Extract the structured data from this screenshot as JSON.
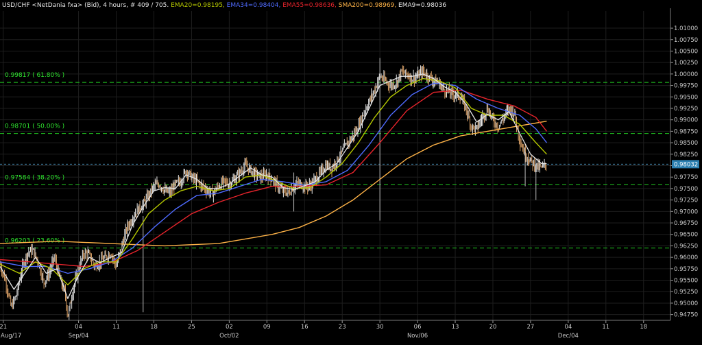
{
  "header": {
    "symbol": "USD/CHF <NetDania fxa> (Bid), 4 hours, # 409 / 705.",
    "indicators": [
      {
        "label": "EMA20=0.98195",
        "color": "#b5c800"
      },
      {
        "label": "EMA34=0.98404",
        "color": "#4f6bff"
      },
      {
        "label": "EMA55=0.98636",
        "color": "#e8242c"
      },
      {
        "label": "SMA200=0.98969",
        "color": "#ffb347"
      },
      {
        "label": "EMA9=0.98036",
        "color": "#e6e6e6"
      }
    ]
  },
  "colors": {
    "background": "#000000",
    "grid": "#1e1e1e",
    "fib": "#22cc22",
    "price_line": "#4a8fb8",
    "price_tag": "#2b7fb0",
    "bar_up": "#e6e6e6",
    "bar_down": "#d9a066"
  },
  "chart_data": {
    "type": "line",
    "title": "USD/CHF <NetDania fxa> (Bid), 4 hours, # 409 / 705.",
    "ylim": [
      0.94625,
      1.01375
    ],
    "y_ticks": [
      "1.01000",
      "1.00750",
      "1.00500",
      "1.00250",
      "1.00000",
      "0.99750",
      "0.99500",
      "0.99250",
      "0.99000",
      "0.98750",
      "0.98500",
      "0.98250",
      "0.98000",
      "0.97750",
      "0.97500",
      "0.97250",
      "0.97000",
      "0.96750",
      "0.96500",
      "0.96250",
      "0.96000",
      "0.95750",
      "0.95500",
      "0.95250",
      "0.95000",
      "0.94750"
    ],
    "y_tick_values": [
      1.01,
      1.0075,
      1.005,
      1.0025,
      1.0,
      0.9975,
      0.995,
      0.9925,
      0.99,
      0.9875,
      0.985,
      0.9825,
      0.98,
      0.9775,
      0.975,
      0.9725,
      0.97,
      0.9675,
      0.965,
      0.9625,
      0.96,
      0.9575,
      0.955,
      0.9525,
      0.95,
      0.9475
    ],
    "x_day_ticks": [
      {
        "day": 0,
        "label": "21"
      },
      {
        "day": 14,
        "label": "04"
      },
      {
        "day": 21,
        "label": "11"
      },
      {
        "day": 28,
        "label": "18"
      },
      {
        "day": 35,
        "label": "25"
      },
      {
        "day": 42,
        "label": "02"
      },
      {
        "day": 49,
        "label": "09"
      },
      {
        "day": 56,
        "label": "16"
      },
      {
        "day": 63,
        "label": "23"
      },
      {
        "day": 70,
        "label": "30"
      },
      {
        "day": 77,
        "label": "06"
      },
      {
        "day": 84,
        "label": "13"
      },
      {
        "day": 91,
        "label": "20"
      },
      {
        "day": 98,
        "label": "27"
      },
      {
        "day": 105,
        "label": "04"
      },
      {
        "day": 112,
        "label": "11"
      },
      {
        "day": 119,
        "label": "18"
      }
    ],
    "x_month_labels": [
      {
        "day": 0,
        "label": "Aug/17"
      },
      {
        "day": 14,
        "label": "Sep/04"
      },
      {
        "day": 42,
        "label": "Oct/02"
      },
      {
        "day": 77,
        "label": "Nov/06"
      },
      {
        "day": 105,
        "label": "Dec/04"
      }
    ],
    "x_day_range": [
      0,
      124
    ],
    "fib_levels": [
      {
        "label": "0.99817 ( 61.80% )",
        "value": 0.99817
      },
      {
        "label": "0.98701 ( 50.00% )",
        "value": 0.98701
      },
      {
        "label": "0.97584 ( 38.20% )",
        "value": 0.97584
      },
      {
        "label": "0.96203 ( 23.60% )",
        "value": 0.96203
      }
    ],
    "current_price": {
      "label": "0.98032",
      "value": 0.98032
    },
    "price_path": [
      [
        -0.6,
        0.9585
      ],
      [
        0.5,
        0.9545
      ],
      [
        1.5,
        0.949
      ],
      [
        2.5,
        0.952
      ],
      [
        3.5,
        0.9575
      ],
      [
        4.5,
        0.961
      ],
      [
        5.5,
        0.9615
      ],
      [
        6.5,
        0.959
      ],
      [
        7.5,
        0.9545
      ],
      [
        8.5,
        0.9565
      ],
      [
        9.5,
        0.96
      ],
      [
        10.5,
        0.9555
      ],
      [
        11.5,
        0.952
      ],
      [
        12,
        0.947
      ],
      [
        13,
        0.953
      ],
      [
        14,
        0.9575
      ],
      [
        15,
        0.961
      ],
      [
        16,
        0.9605
      ],
      [
        17,
        0.958
      ],
      [
        18,
        0.959
      ],
      [
        19,
        0.96
      ],
      [
        20,
        0.961
      ],
      [
        21,
        0.958
      ],
      [
        22,
        0.9625
      ],
      [
        23,
        0.9665
      ],
      [
        24,
        0.9685
      ],
      [
        25,
        0.9705
      ],
      [
        26,
        0.9715
      ],
      [
        27,
        0.9735
      ],
      [
        28,
        0.9755
      ],
      [
        29,
        0.976
      ],
      [
        30,
        0.9745
      ],
      [
        31,
        0.974
      ],
      [
        32,
        0.976
      ],
      [
        33,
        0.9765
      ],
      [
        34,
        0.979
      ],
      [
        35,
        0.9775
      ],
      [
        36,
        0.9765
      ],
      [
        37,
        0.9755
      ],
      [
        38,
        0.9745
      ],
      [
        39,
        0.974
      ],
      [
        40,
        0.9755
      ],
      [
        41,
        0.9765
      ],
      [
        42,
        0.976
      ],
      [
        43,
        0.977
      ],
      [
        44,
        0.9785
      ],
      [
        45,
        0.98
      ],
      [
        46,
        0.979
      ],
      [
        47,
        0.978
      ],
      [
        48,
        0.9775
      ],
      [
        49,
        0.978
      ],
      [
        50,
        0.977
      ],
      [
        51,
        0.9755
      ],
      [
        52,
        0.9745
      ],
      [
        53,
        0.974
      ],
      [
        54,
        0.9755
      ],
      [
        55,
        0.976
      ],
      [
        56,
        0.9755
      ],
      [
        57,
        0.9755
      ],
      [
        58,
        0.977
      ],
      [
        59,
        0.9785
      ],
      [
        60,
        0.98
      ],
      [
        61,
        0.9795
      ],
      [
        62,
        0.981
      ],
      [
        63,
        0.983
      ],
      [
        64,
        0.985
      ],
      [
        65,
        0.9865
      ],
      [
        66,
        0.9885
      ],
      [
        67,
        0.9915
      ],
      [
        68,
        0.994
      ],
      [
        69,
        0.9965
      ],
      [
        70,
        0.9995
      ],
      [
        71,
        0.9985
      ],
      [
        72,
        0.9975
      ],
      [
        73,
        0.998
      ],
      [
        74,
        1.0005
      ],
      [
        75,
        1.0
      ],
      [
        76,
        0.999
      ],
      [
        77,
        0.9995
      ],
      [
        78,
        1.0005
      ],
      [
        79,
        0.9995
      ],
      [
        80,
        0.9985
      ],
      [
        81,
        0.998
      ],
      [
        82,
        0.9965
      ],
      [
        83,
        0.996
      ],
      [
        84,
        0.9955
      ],
      [
        85,
        0.995
      ],
      [
        86,
        0.9925
      ],
      [
        87,
        0.9885
      ],
      [
        88,
        0.988
      ],
      [
        89,
        0.9905
      ],
      [
        90,
        0.9925
      ],
      [
        91,
        0.99
      ],
      [
        92,
        0.9885
      ],
      [
        93,
        0.9905
      ],
      [
        94,
        0.9925
      ],
      [
        95,
        0.9915
      ],
      [
        96,
        0.9855
      ],
      [
        97,
        0.9825
      ],
      [
        98,
        0.981
      ],
      [
        99,
        0.98
      ],
      [
        100,
        0.9795
      ],
      [
        101,
        0.9803
      ]
    ],
    "series": [
      {
        "name": "EMA20",
        "color": "#b5c800",
        "points": [
          [
            -0.6,
            0.9585
          ],
          [
            3,
            0.9565
          ],
          [
            6,
            0.959
          ],
          [
            9,
            0.9575
          ],
          [
            12,
            0.954
          ],
          [
            15,
            0.9575
          ],
          [
            18,
            0.959
          ],
          [
            21,
            0.959
          ],
          [
            24,
            0.964
          ],
          [
            27,
            0.9695
          ],
          [
            30,
            0.9725
          ],
          [
            33,
            0.9745
          ],
          [
            36,
            0.9755
          ],
          [
            39,
            0.9745
          ],
          [
            42,
            0.975
          ],
          [
            45,
            0.9775
          ],
          [
            48,
            0.978
          ],
          [
            51,
            0.9765
          ],
          [
            54,
            0.975
          ],
          [
            57,
            0.9752
          ],
          [
            60,
            0.9775
          ],
          [
            63,
            0.9805
          ],
          [
            66,
            0.985
          ],
          [
            69,
            0.9905
          ],
          [
            72,
            0.995
          ],
          [
            75,
            0.9975
          ],
          [
            78,
            0.999
          ],
          [
            81,
            0.9985
          ],
          [
            84,
            0.997
          ],
          [
            87,
            0.9925
          ],
          [
            90,
            0.991
          ],
          [
            93,
            0.991
          ],
          [
            96,
            0.989
          ],
          [
            99,
            0.985
          ],
          [
            101,
            0.9825
          ]
        ]
      },
      {
        "name": "EMA34",
        "color": "#4f6bff",
        "points": [
          [
            -0.6,
            0.959
          ],
          [
            4,
            0.958
          ],
          [
            8,
            0.958
          ],
          [
            12,
            0.9565
          ],
          [
            16,
            0.9575
          ],
          [
            20,
            0.959
          ],
          [
            24,
            0.962
          ],
          [
            28,
            0.9665
          ],
          [
            32,
            0.9705
          ],
          [
            36,
            0.9735
          ],
          [
            40,
            0.974
          ],
          [
            44,
            0.9755
          ],
          [
            48,
            0.977
          ],
          [
            52,
            0.9765
          ],
          [
            56,
            0.9757
          ],
          [
            60,
            0.9765
          ],
          [
            64,
            0.979
          ],
          [
            68,
            0.9845
          ],
          [
            72,
            0.991
          ],
          [
            76,
            0.9955
          ],
          [
            80,
            0.998
          ],
          [
            84,
            0.9975
          ],
          [
            88,
            0.9945
          ],
          [
            92,
            0.9925
          ],
          [
            96,
            0.991
          ],
          [
            99,
            0.988
          ],
          [
            101,
            0.985
          ]
        ]
      },
      {
        "name": "EMA55",
        "color": "#e8242c",
        "points": [
          [
            -0.6,
            0.9595
          ],
          [
            5,
            0.959
          ],
          [
            10,
            0.9585
          ],
          [
            15,
            0.958
          ],
          [
            20,
            0.9588
          ],
          [
            25,
            0.9615
          ],
          [
            30,
            0.9655
          ],
          [
            35,
            0.9695
          ],
          [
            40,
            0.972
          ],
          [
            45,
            0.974
          ],
          [
            50,
            0.9755
          ],
          [
            55,
            0.9755
          ],
          [
            60,
            0.9758
          ],
          [
            65,
            0.9785
          ],
          [
            70,
            0.985
          ],
          [
            75,
            0.992
          ],
          [
            80,
            0.996
          ],
          [
            85,
            0.9965
          ],
          [
            90,
            0.9945
          ],
          [
            95,
            0.993
          ],
          [
            99,
            0.9905
          ],
          [
            101,
            0.9875
          ]
        ]
      },
      {
        "name": "SMA200",
        "color": "#ffb347",
        "points": [
          [
            -0.6,
            0.963
          ],
          [
            10,
            0.9635
          ],
          [
            20,
            0.963
          ],
          [
            30,
            0.9625
          ],
          [
            40,
            0.963
          ],
          [
            50,
            0.965
          ],
          [
            55,
            0.9665
          ],
          [
            60,
            0.969
          ],
          [
            65,
            0.9725
          ],
          [
            70,
            0.977
          ],
          [
            75,
            0.9815
          ],
          [
            80,
            0.9845
          ],
          [
            85,
            0.9865
          ],
          [
            90,
            0.9875
          ],
          [
            95,
            0.9885
          ],
          [
            101,
            0.9897
          ]
        ]
      },
      {
        "name": "EMA9",
        "color": "#e6e6e6",
        "points": [
          [
            -0.6,
            0.958
          ],
          [
            2,
            0.953
          ],
          [
            4,
            0.9565
          ],
          [
            6,
            0.96
          ],
          [
            8,
            0.9565
          ],
          [
            10,
            0.9575
          ],
          [
            12,
            0.951
          ],
          [
            14,
            0.956
          ],
          [
            16,
            0.96
          ],
          [
            18,
            0.9588
          ],
          [
            20,
            0.96
          ],
          [
            22,
            0.961
          ],
          [
            24,
            0.967
          ],
          [
            26,
            0.971
          ],
          [
            28,
            0.9745
          ],
          [
            30,
            0.9752
          ],
          [
            32,
            0.975
          ],
          [
            34,
            0.978
          ],
          [
            36,
            0.977
          ],
          [
            38,
            0.975
          ],
          [
            40,
            0.975
          ],
          [
            42,
            0.976
          ],
          [
            44,
            0.9778
          ],
          [
            46,
            0.9795
          ],
          [
            48,
            0.978
          ],
          [
            50,
            0.9775
          ],
          [
            52,
            0.9752
          ],
          [
            54,
            0.9748
          ],
          [
            56,
            0.9756
          ],
          [
            58,
            0.9765
          ],
          [
            60,
            0.979
          ],
          [
            62,
            0.9805
          ],
          [
            64,
            0.984
          ],
          [
            66,
            0.9875
          ],
          [
            68,
            0.9925
          ],
          [
            70,
            0.9975
          ],
          [
            72,
            0.9985
          ],
          [
            74,
            0.9995
          ],
          [
            76,
            0.9995
          ],
          [
            78,
            1.0
          ],
          [
            80,
            0.999
          ],
          [
            82,
            0.9972
          ],
          [
            84,
            0.996
          ],
          [
            86,
            0.9935
          ],
          [
            88,
            0.9895
          ],
          [
            90,
            0.9912
          ],
          [
            92,
            0.99
          ],
          [
            94,
            0.9918
          ],
          [
            96,
            0.987
          ],
          [
            98,
            0.9825
          ],
          [
            100,
            0.9805
          ],
          [
            101,
            0.9804
          ]
        ]
      }
    ],
    "spikes": [
      {
        "day": 70,
        "high": 1.0035,
        "low": 0.968
      },
      {
        "day": 26,
        "high": 0.969,
        "low": 0.948
      },
      {
        "day": 97,
        "high": 0.983,
        "low": 0.9755
      },
      {
        "day": 99,
        "high": 0.9815,
        "low": 0.9725
      },
      {
        "day": 54,
        "high": 0.9785,
        "low": 0.97
      }
    ]
  }
}
